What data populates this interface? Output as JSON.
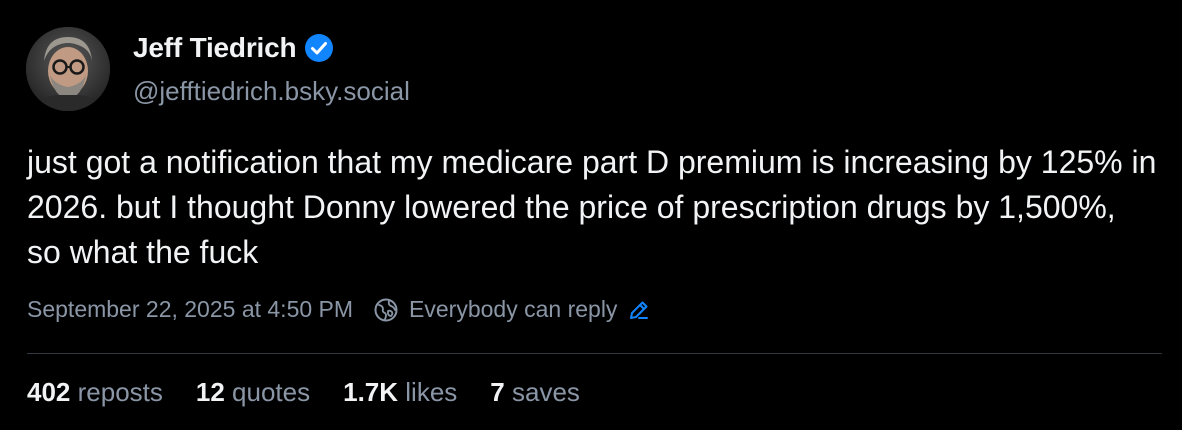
{
  "author": {
    "display_name": "Jeff Tiedrich",
    "handle": "@jefftiedrich.bsky.social",
    "avatar_icon": "person-with-glasses-avatar",
    "verified": true,
    "verified_color": "#1185fe"
  },
  "post": {
    "text": "just got a notification that my medicare part D premium is increasing by 125% in 2026. but I thought Donny lowered the price of prescription drugs by 1,500%, so what the fuck"
  },
  "meta": {
    "timestamp": "September 22, 2025 at 4:50 PM",
    "reply_setting": "Everybody can reply",
    "reply_setting_icon": "globe-icon",
    "edit_icon": "pencil-icon",
    "accent_color": "#1185fe"
  },
  "stats": {
    "reposts_count": "402",
    "reposts_label": "reposts",
    "quotes_count": "12",
    "quotes_label": "quotes",
    "likes_count": "1.7K",
    "likes_label": "likes",
    "saves_count": "7",
    "saves_label": "saves"
  }
}
